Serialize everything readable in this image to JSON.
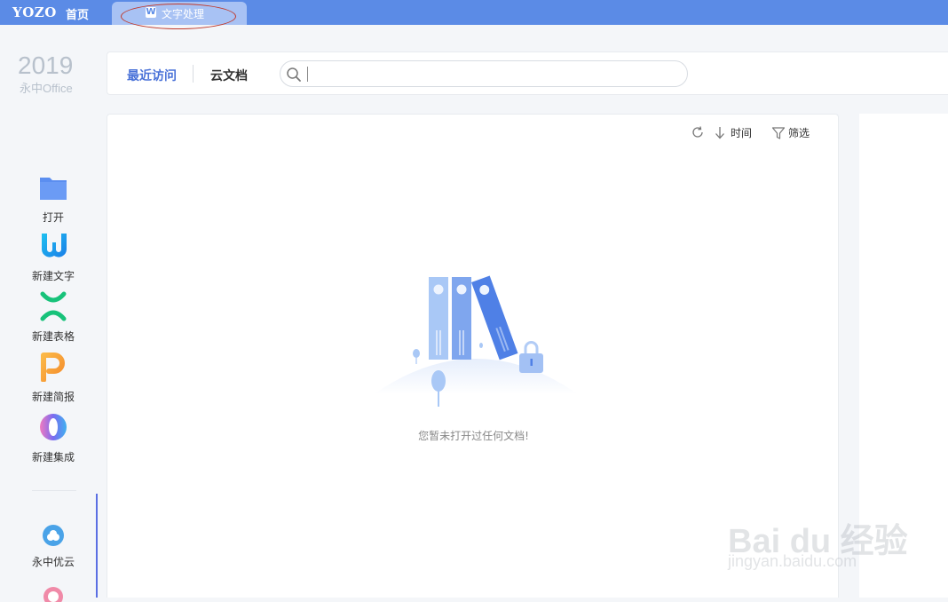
{
  "topbar": {
    "logo": "YOZO",
    "home": "首页",
    "active_tab": {
      "icon": "W",
      "label": "文字处理"
    }
  },
  "brand": {
    "year": "2019",
    "name": "永中Office"
  },
  "sidebar": {
    "items": [
      {
        "label": "打开",
        "icon": "folder-icon",
        "color": "#5b8ef0"
      },
      {
        "label": "新建文字",
        "icon": "writer-w-icon",
        "color": "#1aa7e8"
      },
      {
        "label": "新建表格",
        "icon": "sheet-x-icon",
        "color": "#17c27a"
      },
      {
        "label": "新建简报",
        "icon": "presentation-p-icon",
        "color": "#f7a23b"
      },
      {
        "label": "新建集成",
        "icon": "integrated-icon",
        "color": "#7a6cf0"
      }
    ],
    "cloud": {
      "label": "永中优云",
      "icon": "cloud-icon"
    }
  },
  "nav": {
    "recent": "最近访问",
    "cloud_docs": "云文档",
    "search": {
      "value": "",
      "placeholder": ""
    }
  },
  "toolbar": {
    "refresh_icon": "refresh-icon",
    "sort_label": "时间",
    "sort_icon": "sort-down-icon",
    "filter_label": "筛选",
    "filter_icon": "filter-icon"
  },
  "empty_state": {
    "message": "您暂未打开过任何文档!",
    "illustration": "binders-lock-illustration"
  },
  "watermark": {
    "brand": "Bai du 经验",
    "url": "jingyan.baidu.com"
  },
  "colors": {
    "accent": "#5b8be6",
    "tab": "#a8c2f4",
    "link": "#4a72d8"
  }
}
